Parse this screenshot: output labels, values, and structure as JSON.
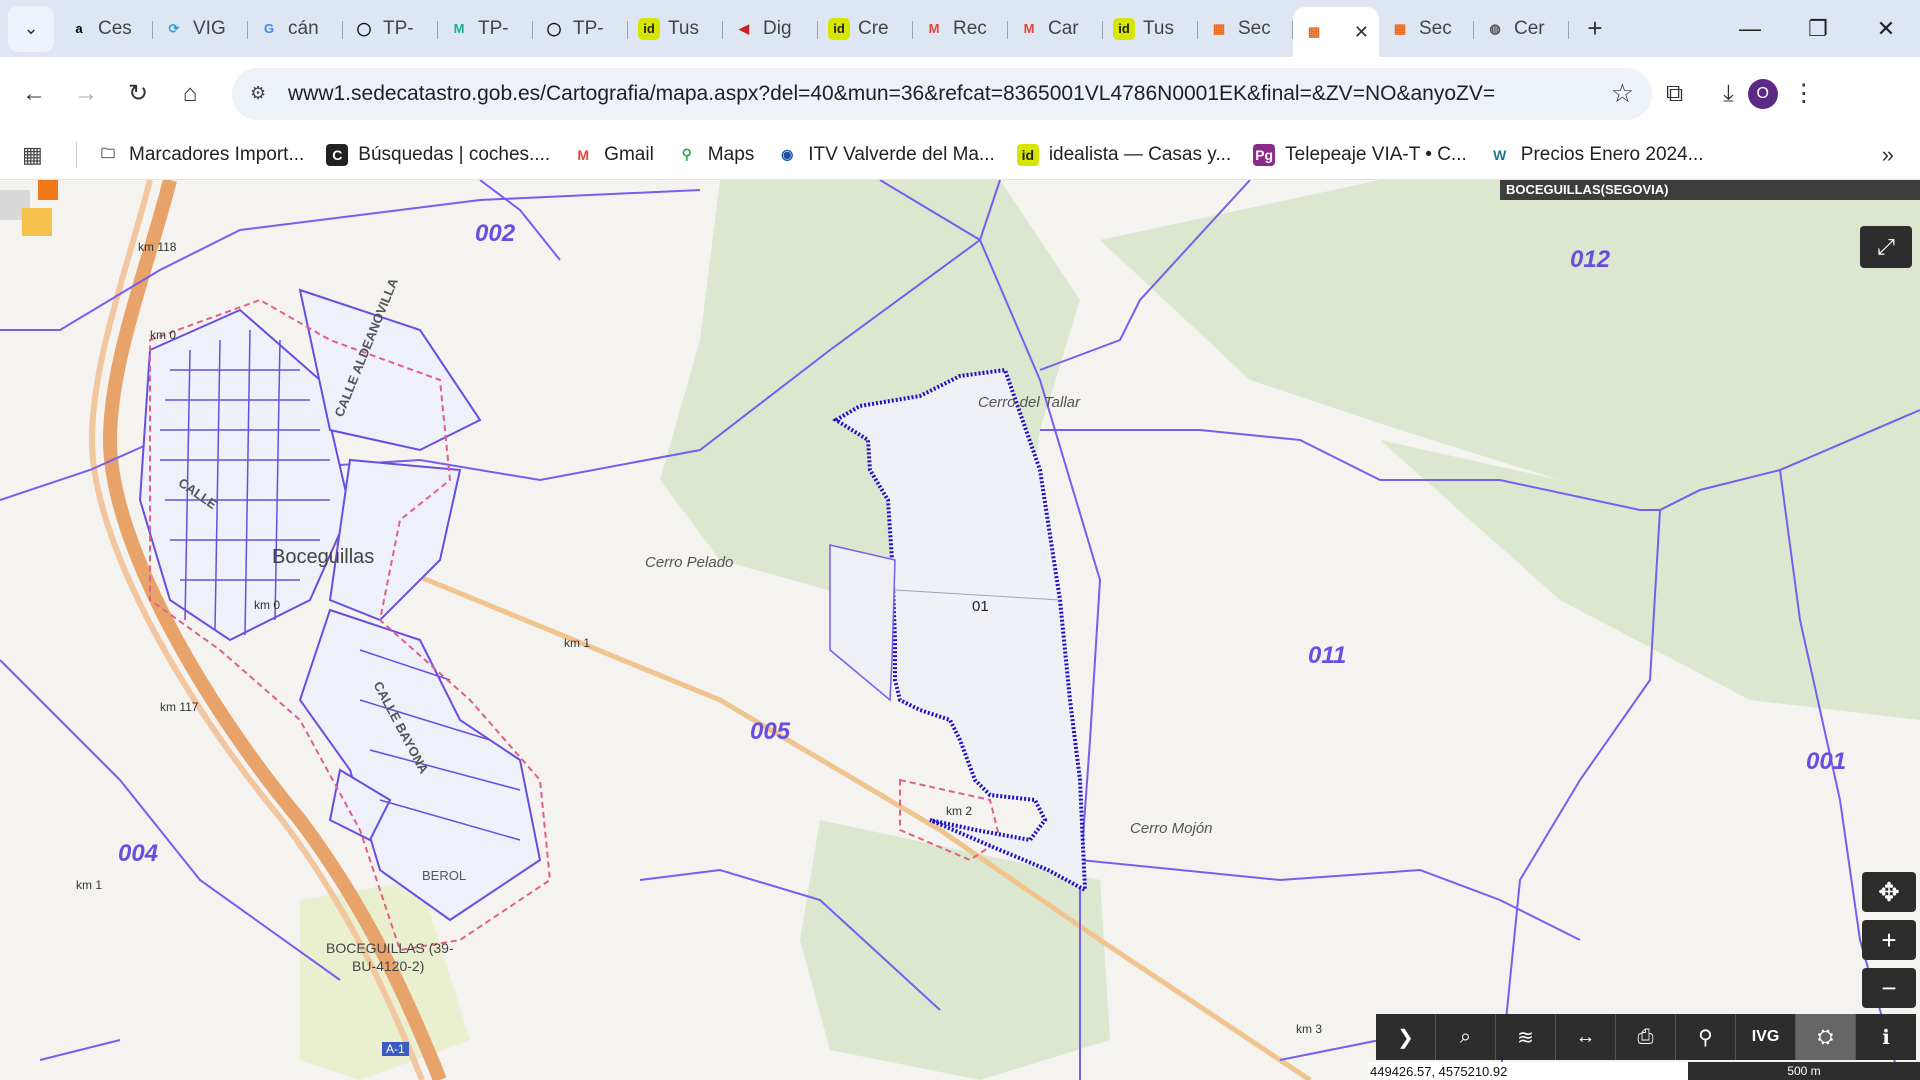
{
  "browser": {
    "tabs": [
      {
        "label": "Ces",
        "icon": "amazon-icon",
        "color": "#000000"
      },
      {
        "label": "VIG",
        "icon": "vig-icon",
        "color": "#2aa3d6"
      },
      {
        "label": "cán",
        "icon": "google-icon",
        "color": "#4285f4"
      },
      {
        "label": "TP-",
        "icon": "loop-icon",
        "color": "#111111"
      },
      {
        "label": "TP-",
        "icon": "m-icon",
        "color": "#19b394"
      },
      {
        "label": "TP-",
        "icon": "loop-icon",
        "color": "#111111"
      },
      {
        "label": "Tus",
        "icon": "idealista-icon",
        "color": "#d7e600"
      },
      {
        "label": "Dig",
        "icon": "dgt-icon",
        "color": "#cc2222"
      },
      {
        "label": "Cre",
        "icon": "idealista-icon",
        "color": "#d7e600"
      },
      {
        "label": "Rec",
        "icon": "gmail-icon",
        "color": "#ea4335"
      },
      {
        "label": "Car",
        "icon": "gmail-icon",
        "color": "#ea4335"
      },
      {
        "label": "Tus",
        "icon": "idealista-icon",
        "color": "#d7e600"
      },
      {
        "label": "Sec",
        "icon": "catastro-icon",
        "color": "#e86a1e"
      },
      {
        "label": "",
        "icon": "catastro-icon",
        "color": "#e86a1e",
        "active": true
      },
      {
        "label": "Sec",
        "icon": "catastro-icon",
        "color": "#e86a1e"
      },
      {
        "label": "Cer",
        "icon": "globe-icon",
        "color": "#555555"
      }
    ],
    "url": "www1.sedecatastro.gob.es/Cartografia/mapa.aspx?del=40&mun=36&refcat=8365001VL4786N0001EK&final=&ZV=NO&anyoZV=",
    "profile_initial": "O",
    "bookmarks": [
      {
        "label": "Marcadores Import...",
        "icon": "folder-icon",
        "color": "#444444"
      },
      {
        "label": "Búsquedas | coches....",
        "icon": "coches-icon",
        "color": "#222222"
      },
      {
        "label": "Gmail",
        "icon": "gmail-icon",
        "color": "#ea4335"
      },
      {
        "label": "Maps",
        "icon": "maps-icon",
        "color": "#34a853"
      },
      {
        "label": "ITV Valverde del Ma...",
        "icon": "itv-icon",
        "color": "#1a4fa3"
      },
      {
        "label": "idealista — Casas y...",
        "icon": "idealista-icon",
        "color": "#d7e600"
      },
      {
        "label": "Telepeaje VIA-T • C...",
        "icon": "telepeaje-icon",
        "color": "#8a2a8a"
      },
      {
        "label": "Precios Enero 2024...",
        "icon": "wordpress-icon",
        "color": "#21759b"
      }
    ]
  },
  "map": {
    "municipality": "BOCEGUILLAS(SEGOVIA)",
    "polygon_numbers": [
      "002",
      "012",
      "011",
      "005",
      "001",
      "004"
    ],
    "places": [
      "Cerro del Tallar",
      "Cerro Pelado",
      "Cerro Mojón"
    ],
    "parcel_label": "01",
    "town": "Boceguillas",
    "streets": [
      "CALLE ALDEANOVILLA",
      "CALLE BAYONA",
      "CALLE"
    ],
    "road_kms": [
      "km 118",
      "km 0",
      "km 1",
      "km 117",
      "km 2",
      "km 1",
      "km 3",
      "km 0"
    ],
    "other_labels": [
      "BOCEGUILLAS (39-",
      "BU-4120-2)",
      "BEROL",
      "A-1"
    ],
    "coordinates": "449426.57, 4575210.92",
    "scale": "500 m",
    "tool_icons": [
      "chevron-right-icon",
      "search-icon",
      "layers-icon",
      "measure-icon",
      "print-icon",
      "location-pin-icon",
      "ivg-icon",
      "overview-icon",
      "info-icon"
    ],
    "tool_labels": {
      "ivg": "IVG"
    },
    "colors": {
      "parcel_outline": "#1e10c8",
      "polygon_lines": "#7a5cf0",
      "urban_boundary": "#e0608a",
      "forest": "#dbe8cf",
      "road": "#e8a36a"
    }
  }
}
